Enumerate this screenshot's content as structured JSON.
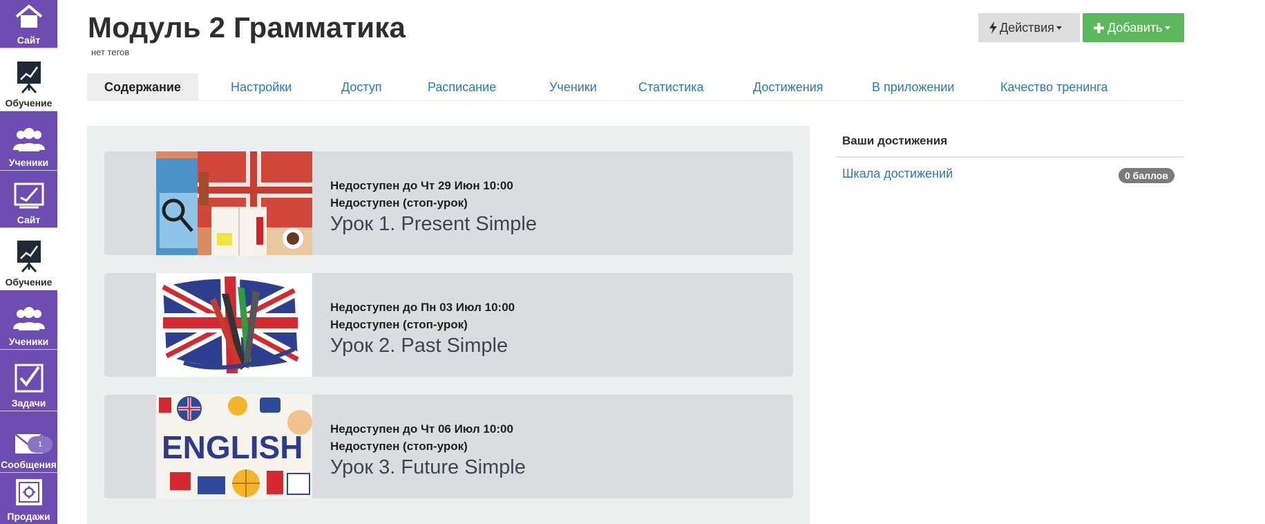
{
  "sidebar": {
    "items": [
      {
        "label": "Сайт",
        "icon": "home-icon",
        "theme": "purple"
      },
      {
        "label": "Обучение",
        "icon": "training-board-icon",
        "theme": "white"
      },
      {
        "label": "Ученики",
        "icon": "users-icon",
        "theme": "purple"
      },
      {
        "label": "Сайт",
        "icon": "site-screen-icon",
        "theme": "purple"
      },
      {
        "label": "Обучение",
        "icon": "training-board-icon",
        "theme": "white"
      },
      {
        "label": "Ученики",
        "icon": "users-icon",
        "theme": "purple"
      },
      {
        "label": "Задачи",
        "icon": "tasks-check-icon",
        "theme": "purple"
      },
      {
        "label": "Сообщения",
        "icon": "envelope-icon",
        "theme": "purple",
        "badge": "1"
      },
      {
        "label": "Продажи",
        "icon": "safe-icon",
        "theme": "purple"
      }
    ]
  },
  "header": {
    "title": "Модуль 2 Грамматика",
    "tags": "нет тегов",
    "actions_label": "Действия",
    "add_label": "Добавить"
  },
  "tabs": [
    {
      "label": "Содержание",
      "active": true
    },
    {
      "label": "Настройки"
    },
    {
      "label": "Доступ"
    },
    {
      "label": "Расписание"
    },
    {
      "label": "Ученики"
    },
    {
      "label": "Статистика"
    },
    {
      "label": "Достижения"
    },
    {
      "label": "В приложении"
    },
    {
      "label": "Качество тренинга"
    }
  ],
  "lessons": [
    {
      "availability": "Недоступен до Чт 29 Июн 10:00",
      "status": "Недоступен (стоп-урок)",
      "title": "Урок 1. Present Simple",
      "thumb": "uk-travel-collage-image"
    },
    {
      "availability": "Недоступен до Пн 03 Июл 10:00",
      "status": "Недоступен (стоп-урок)",
      "title": "Урок 2. Past Simple",
      "thumb": "uk-flag-pencils-image"
    },
    {
      "availability": "Недоступен до Чт 06 Июл 10:00",
      "status": "Недоступен (стоп-урок)",
      "title": "Урок 3. Future Simple",
      "thumb": "english-word-collage-image",
      "thumb_text": "ENGLISH"
    }
  ],
  "achievements": {
    "title": "Ваши достижения",
    "link": "Шкала достижений",
    "points": "0 баллов"
  },
  "colors": {
    "sidebar_purple": "#6e4db3",
    "link_blue": "#2a7ab8",
    "add_green": "#5cb85c",
    "panel_bg": "#eceff0",
    "lesson_bg": "#d9dde0"
  }
}
